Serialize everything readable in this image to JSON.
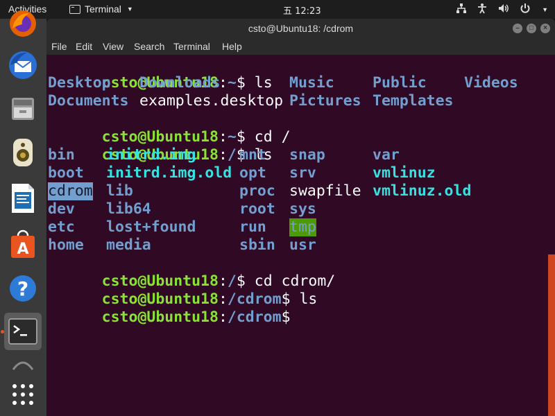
{
  "topbar": {
    "activities": "Activities",
    "app_name": "Terminal",
    "clock": "五 12:23",
    "tray_icons": [
      "network-icon",
      "accessibility-icon",
      "volume-icon",
      "power-icon"
    ]
  },
  "dock": {
    "items": [
      "firefox",
      "thunderbird",
      "files",
      "rhythmbox",
      "libreoffice-writer",
      "software",
      "help",
      "terminal",
      "trash",
      "show-apps"
    ]
  },
  "window": {
    "title": "csto@Ubuntu18: /cdrom",
    "menu": [
      "File",
      "Edit",
      "View",
      "Search",
      "Terminal",
      "Help"
    ]
  },
  "terminal": {
    "user_host": "csto@Ubuntu18",
    "lines": [
      {
        "path": "~",
        "cmd": " ls"
      },
      {
        "home_row1": [
          "Desktop",
          "Downloads",
          "Music",
          "Public",
          "Videos"
        ]
      },
      {
        "home_row2": [
          "Documents",
          "examples.desktop",
          "Pictures",
          "Templates"
        ]
      },
      {
        "path": "~",
        "cmd": " cd /"
      },
      {
        "path": "/",
        "cmd": " ls"
      }
    ],
    "root_rows": [
      [
        "bin",
        "initrd.img",
        "mnt",
        "snap",
        "var"
      ],
      [
        "boot",
        "initrd.img.old",
        "opt",
        "srv",
        "vmlinuz"
      ],
      [
        "cdrom",
        "lib",
        "proc",
        "swapfile",
        "vmlinuz.old"
      ],
      [
        "dev",
        "lib64",
        "root",
        "sys",
        ""
      ],
      [
        "etc",
        "lost+found",
        "run",
        "tmp",
        ""
      ],
      [
        "home",
        "media",
        "sbin",
        "usr",
        ""
      ]
    ],
    "cmd_cd_cdrom": {
      "path": "/",
      "cmd": " cd cdrom/"
    },
    "cmd_ls_cdrom": {
      "path": "/cdrom",
      "cmd": " ls"
    },
    "prompt_final": {
      "path": "/cdrom",
      "cmd": ""
    }
  }
}
